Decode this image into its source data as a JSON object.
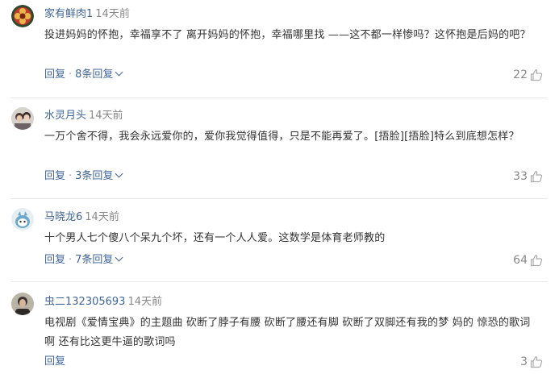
{
  "comments": [
    {
      "username": "家有鲜肉1",
      "time": "14天前",
      "content": "投进妈妈的怀抱，幸福享不了 离开妈妈的怀抱，幸福哪里找 ——这不都一样惨吗？这怀抱是后妈的吧？",
      "reply_label": "回复",
      "more_replies": "8条回复",
      "likes": "22",
      "avatar_icon": "flower-avatar"
    },
    {
      "username": "水灵月头",
      "time": "14天前",
      "content": "一万个舍不得，我会永远爱你的，爱你我觉得值得，只是不能再爱了。[捂脸][捂脸]特么到底想怎样？",
      "reply_label": "回复",
      "more_replies": "3条回复",
      "likes": "33",
      "avatar_icon": "photo-avatar"
    },
    {
      "username": "马晓龙6",
      "time": "14天前",
      "content": "十个男人七个傻八个呆九个坏，还有一个人人爱。这数学是体育老师教的",
      "reply_label": "回复",
      "more_replies": "7条回复",
      "likes": "64",
      "avatar_icon": "cartoon-avatar"
    },
    {
      "username": "虫二132305693",
      "time": "14天前",
      "content": "电视剧《爱情宝典》的主题曲 砍断了脖子有腰 砍断了腰还有脚 砍断了双脚还有我的梦 妈的 惊恐的歌词啊 还有比这更牛逼的歌词吗",
      "reply_label": "回复",
      "more_replies": "",
      "likes": "3",
      "avatar_icon": "portrait-avatar"
    }
  ]
}
